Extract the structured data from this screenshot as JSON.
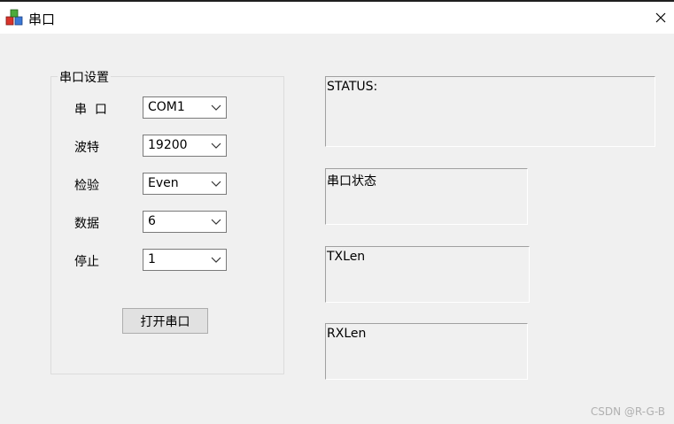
{
  "window": {
    "title": "串口",
    "icon": "app-blocks-icon",
    "close_icon": "close-icon"
  },
  "settings_group": {
    "title": "串口设置",
    "fields": [
      {
        "label": "串  口",
        "value": "COM1"
      },
      {
        "label": "波特",
        "value": "19200"
      },
      {
        "label": "检验",
        "value": "Even"
      },
      {
        "label": "数据",
        "value": "6"
      },
      {
        "label": "停止",
        "value": "1"
      }
    ],
    "open_button": "打开串口"
  },
  "panels": {
    "status": "STATUS:",
    "port_state": "串口状态",
    "tx": "TXLen",
    "rx": "RXLen"
  },
  "watermark": "CSDN @R-G-B",
  "colors": {
    "background": "#f0f0f0",
    "titlebar": "#ffffff",
    "button": "#e1e1e1"
  }
}
